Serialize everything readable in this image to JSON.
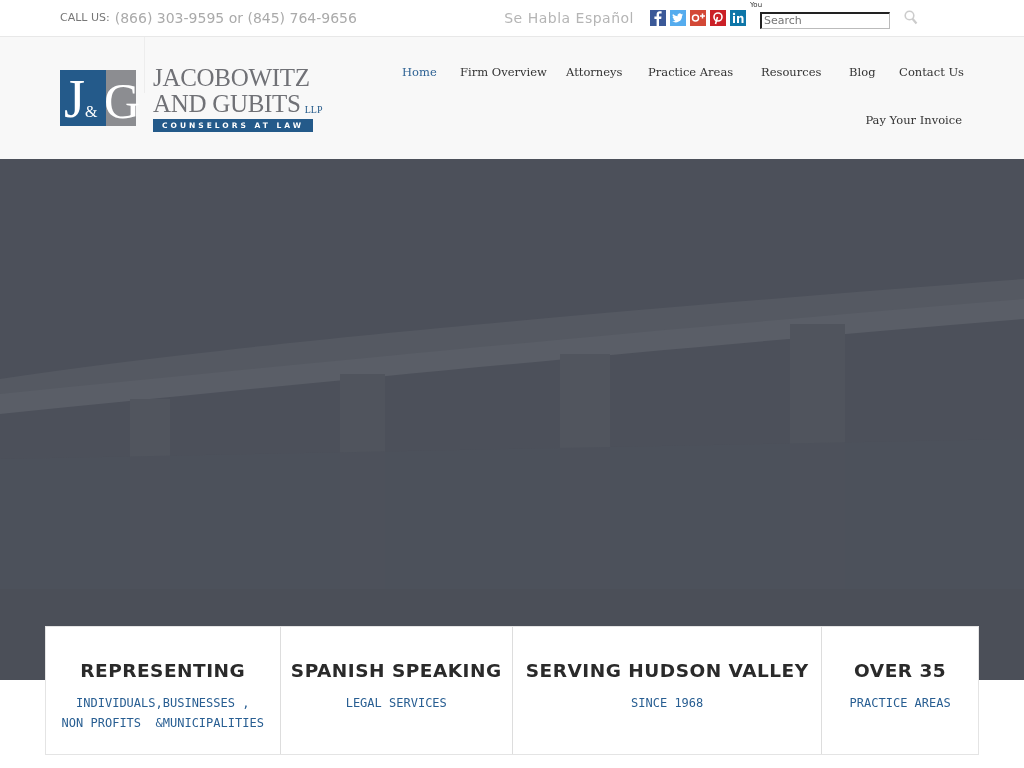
{
  "topbar": {
    "call_label": "CALL US:",
    "phones": "(866) 303-9595 or (845) 764-9656",
    "spanish": "Se Habla Español",
    "youtube_label": "You",
    "search": {
      "placeholder": "Search"
    }
  },
  "logo": {
    "monogram_j": "J",
    "monogram_amp": "&",
    "monogram_g": "G",
    "name_line1": "JACOBOWITZ",
    "name_line2": "AND GUBITS",
    "suffix": "LLP",
    "tagline": "COUNSELORS AT LAW"
  },
  "nav": [
    {
      "label": "Home",
      "selected": true
    },
    {
      "label": "Firm Overview",
      "selected": false
    },
    {
      "label": "Attorneys",
      "selected": false
    },
    {
      "label": "Practice Areas",
      "selected": false
    },
    {
      "label": "Resources",
      "selected": false
    },
    {
      "label": "Blog",
      "selected": false
    },
    {
      "label": "Contact Us",
      "selected": false
    },
    {
      "label": "Pay Your Invoice",
      "selected": false
    }
  ],
  "stats": [
    {
      "title": "REPRESENTING",
      "lines": [
        "INDIVIDUALS,BUSINESSES ,",
        "NON PROFITS  &MUNICIPALITIES"
      ]
    },
    {
      "title": "SPANISH SPEAKING",
      "lines": [
        "LEGAL SERVICES"
      ]
    },
    {
      "title": "SERVING HUDSON VALLEY",
      "lines": [
        "SINCE 1968"
      ]
    },
    {
      "title": "OVER 35",
      "lines": [
        "PRACTICE AREAS"
      ]
    }
  ]
}
